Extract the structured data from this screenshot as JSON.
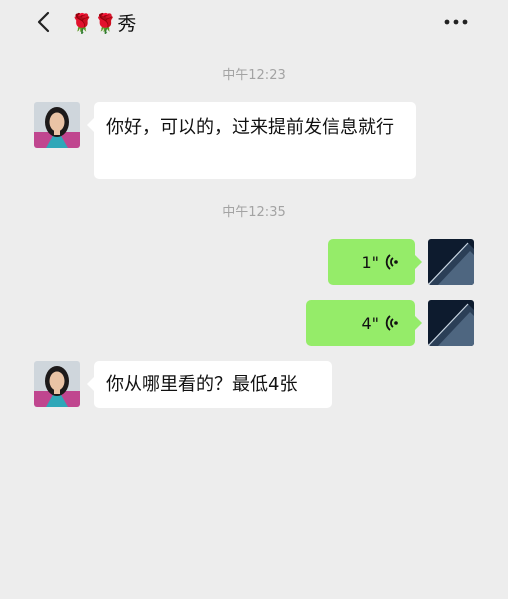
{
  "header": {
    "title": "🌹🌹秀",
    "back_icon": "chevron-left-icon",
    "more_icon": "ellipsis-icon"
  },
  "messages": [
    {
      "type": "timestamp",
      "text": "中午12:23"
    },
    {
      "type": "text",
      "from": "contact",
      "text": "你好，可以的，过来提前发信息就行"
    },
    {
      "type": "timestamp",
      "text": "中午12:35"
    },
    {
      "type": "voice",
      "from": "me",
      "duration": "1\""
    },
    {
      "type": "voice",
      "from": "me",
      "duration": "4\""
    },
    {
      "type": "text",
      "from": "contact",
      "text": "你从哪里看的？最低4张"
    }
  ],
  "colors": {
    "background": "#ededed",
    "outgoing_bubble": "#95ec69",
    "incoming_bubble": "#ffffff",
    "timestamp": "#a3a3a3"
  }
}
